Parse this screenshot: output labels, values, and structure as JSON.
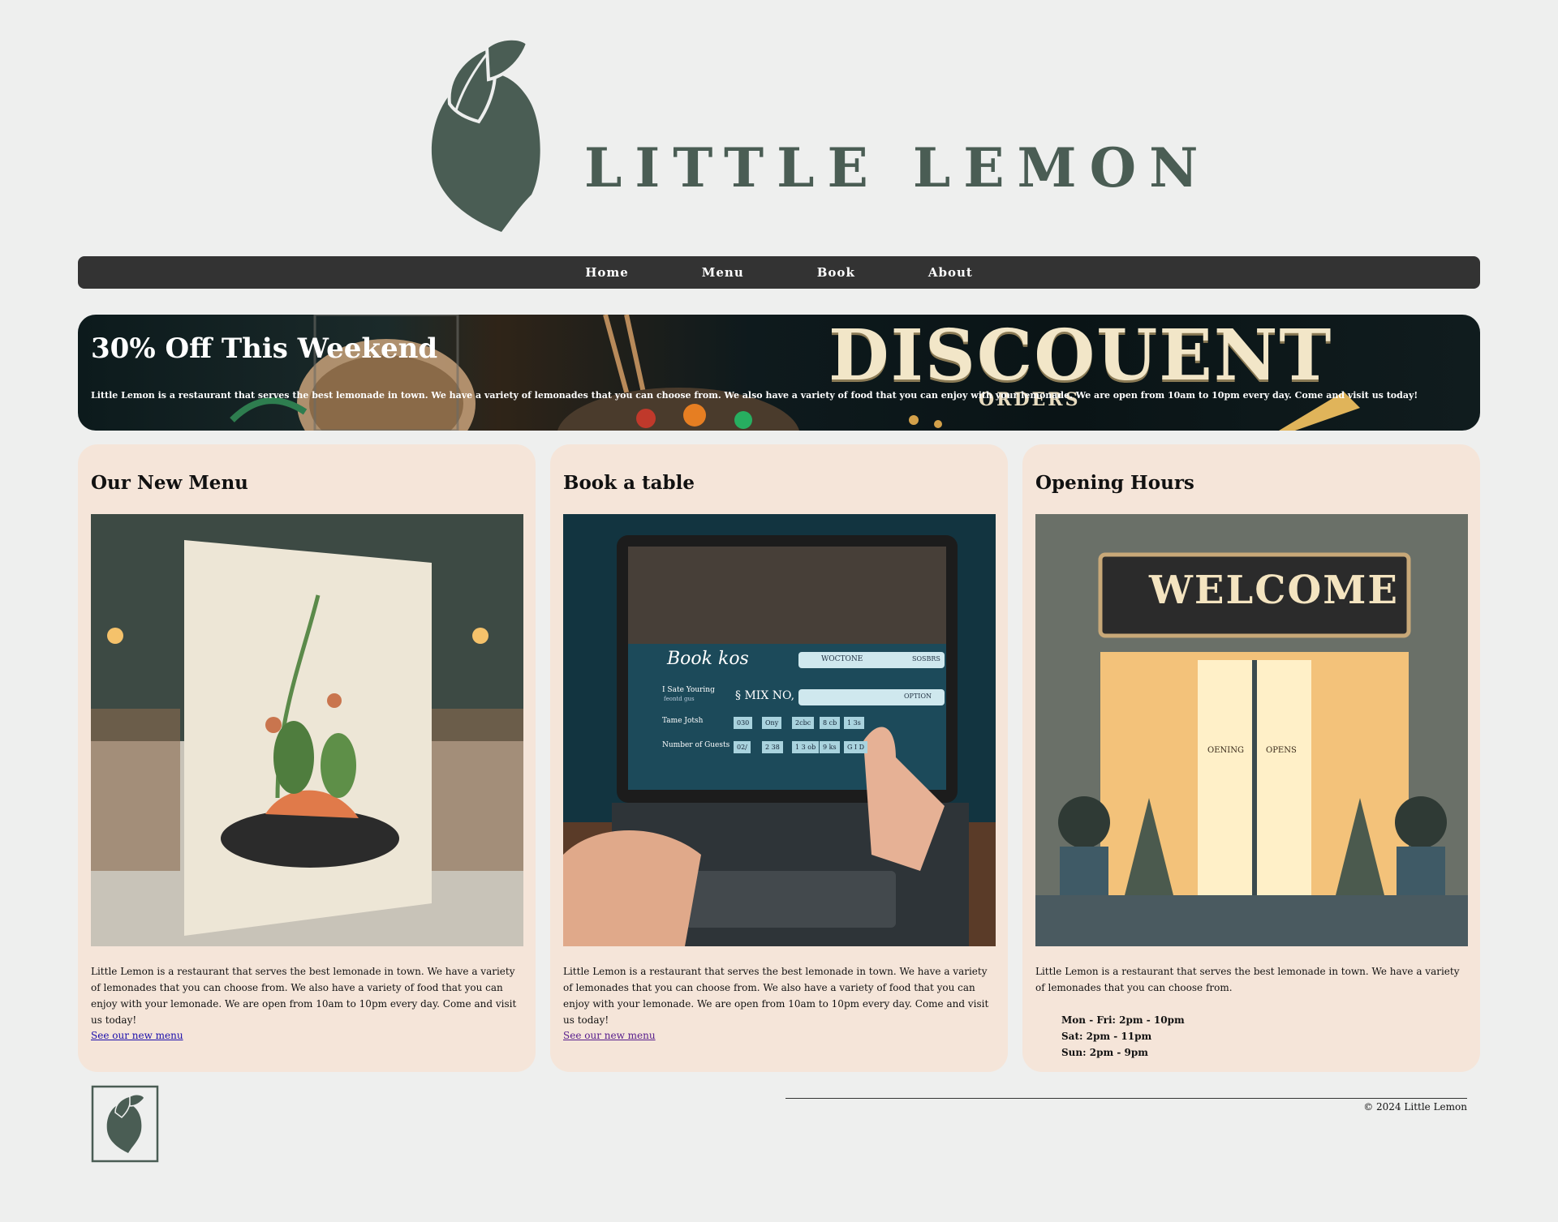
{
  "brand": {
    "name": "LITTLE LEMON"
  },
  "nav": {
    "items": [
      "Home",
      "Menu",
      "Book",
      "About"
    ]
  },
  "hero": {
    "title": "30% Off This Weekend",
    "text": "Little Lemon is a restaurant that serves the best lemonade in town. We have a variety of lemonades that you can choose from. We also have a variety of food that you can enjoy with your lemonade. We are open from 10am to 10pm every day. Come and visit us today!",
    "image_word": "DISCOUENT",
    "image_subword": "ORDERS"
  },
  "cards": {
    "menu": {
      "title": "Our New Menu",
      "text": "Little Lemon is a restaurant that serves the best lemonade in town. We have a variety of lemonades that you can choose from. We also have a variety of food that you can enjoy with your lemonade. We are open from 10am to 10pm every day. Come and visit us today!",
      "link": "See our new menu"
    },
    "book": {
      "title": "Book a table",
      "text": "Little Lemon is a restaurant that serves the best lemonade in town. We have a variety of lemonades that you can choose from. We also have a variety of food that you can enjoy with your lemonade. We are open from 10am to 10pm every day. Come and visit us today!",
      "link": "See our new menu",
      "screen": {
        "heading": "Book kos",
        "search": "WOCTONE",
        "search_right": "SOSBRS",
        "label_1": "I Sate Youring",
        "label_1b": "feontd gus",
        "mix": "§ MIX NO,",
        "option": "OPTION",
        "label_2": "Tame Jotsh",
        "label_3": "Number of Guests",
        "chips_1": [
          "030",
          "Ony",
          "2cbc",
          "8 cb",
          "1 3s"
        ],
        "chips_2": [
          "02/",
          "2 38",
          "1 3 ob",
          "9 ks",
          "G I D"
        ]
      }
    },
    "hours": {
      "title": "Opening Hours",
      "text": "Little Lemon is a restaurant that serves the best lemonade in town. We have a variety of lemonades that you can choose from.",
      "sign": "WELCOME",
      "door_left": "OENING",
      "door_right": "OPENS",
      "schedule": [
        "Mon - Fri: 2pm - 10pm",
        "Sat: 2pm - 11pm",
        "Sun: 2pm - 9pm"
      ]
    }
  },
  "footer": {
    "copyright": "© 2024 Little Lemon"
  },
  "colors": {
    "brand_green": "#4a5d54",
    "nav_bg": "#333333",
    "card_bg": "#f5e5d9",
    "page_bg": "#eeefee"
  }
}
